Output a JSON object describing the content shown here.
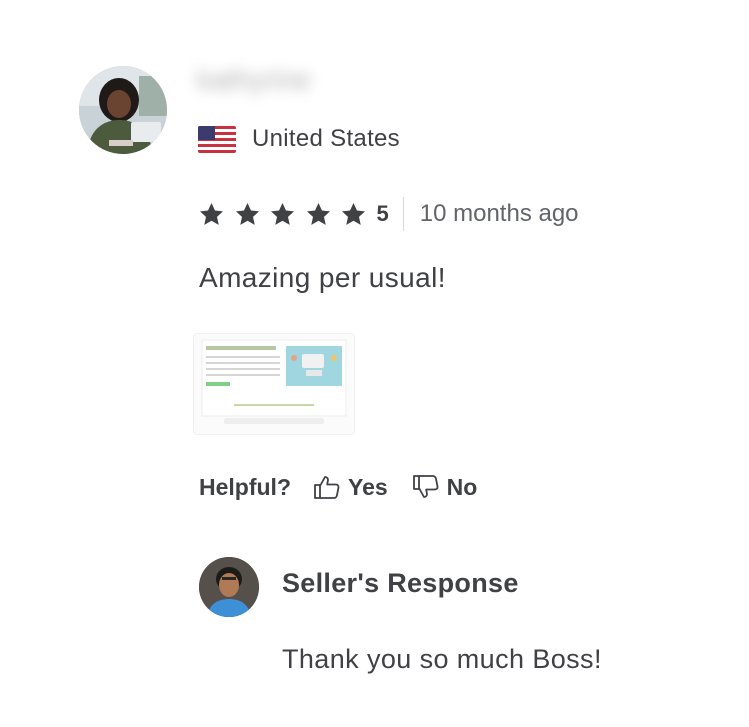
{
  "review": {
    "username": "kathyrine",
    "country": "United States",
    "flag_icon": "us-flag-icon",
    "rating": {
      "stars": 5,
      "value": "5",
      "star_color": "#404145"
    },
    "time_ago": "10 months ago",
    "text": "Amazing per usual!",
    "helpful": {
      "label": "Helpful?",
      "yes_label": "Yes",
      "no_label": "No",
      "yes_icon": "thumbs-up-icon",
      "no_icon": "thumbs-down-icon"
    },
    "seller_response": {
      "title": "Seller's Response",
      "text": "Thank you so much Boss!"
    }
  },
  "colors": {
    "text": "#404145",
    "muted_text": "#62646a",
    "divider": "#dadbdd"
  }
}
